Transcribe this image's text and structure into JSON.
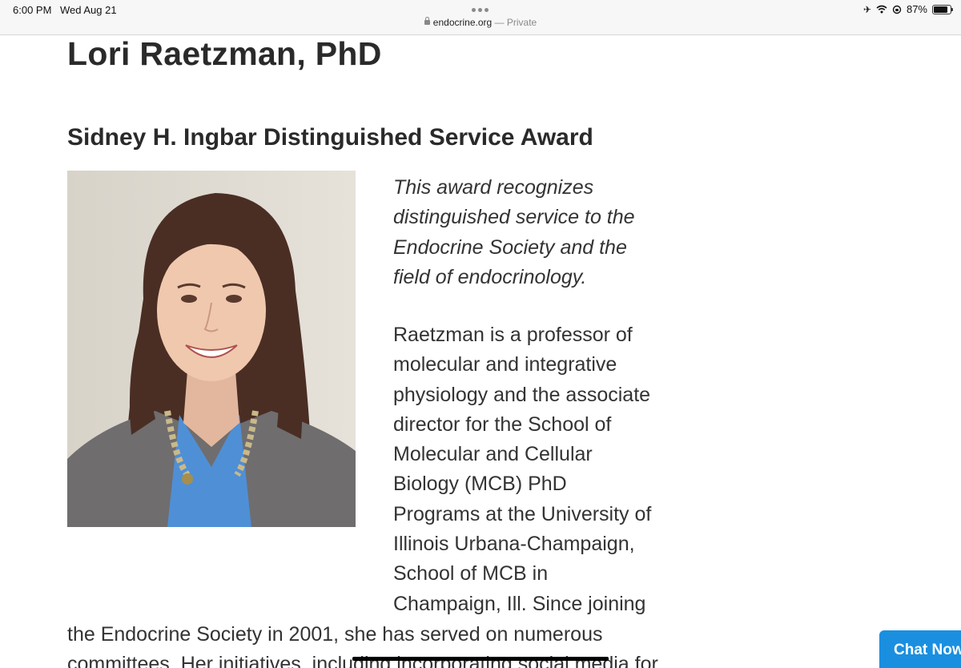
{
  "status_bar": {
    "time": "6:00 PM",
    "date": "Wed Aug 21",
    "battery_percent": "87%",
    "battery_level": 0.87,
    "icons": [
      "airplane-icon",
      "wifi-icon",
      "orientation-lock-icon",
      "battery-icon"
    ]
  },
  "browser": {
    "host": "endocrine.org",
    "mode": " — Private"
  },
  "article": {
    "title": "Lori Raetzman, PhD",
    "award_title": "Sidney H. Ingbar Distinguished Service Award",
    "award_description_lines": [
      "This award recognizes",
      "distinguished service to the",
      "Endocrine Society and the",
      "field of endocrinology."
    ],
    "bio_lines": [
      "Raetzman is a professor of",
      "molecular and integrative",
      "physiology and the associate",
      "director for the School of",
      "Molecular and Cellular",
      "Biology (MCB) PhD",
      "Programs at the University of",
      "Illinois Urbana-Champaign,",
      "School of MCB in",
      "Champaign, Ill. Since joining"
    ],
    "bio_wide_lines": [
      "the Endocrine Society in 2001, she has served on numerous",
      "committees. Her initiatives, including incorporating social media for"
    ]
  },
  "chat": {
    "label": "Chat Now!"
  },
  "colors": {
    "chat_button": "#1a8fe0",
    "text": "#333333",
    "heading": "#2a2a2a"
  }
}
